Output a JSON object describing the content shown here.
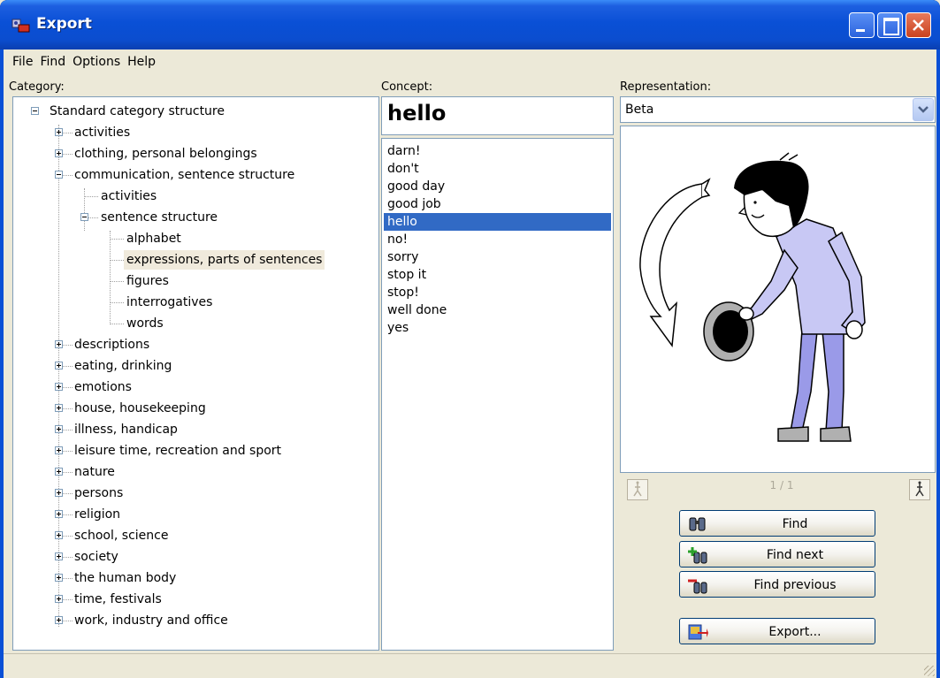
{
  "window": {
    "title": "Export"
  },
  "menu": [
    "File",
    "Find",
    "Options",
    "Help"
  ],
  "labels": {
    "category": "Category:",
    "concept": "Concept:",
    "representation": "Representation:"
  },
  "tree": {
    "root": "Standard category structure",
    "items": [
      "activities",
      "clothing, personal belongings",
      "communication, sentence structure",
      "activities",
      "sentence structure",
      "alphabet",
      "expressions, parts of sentences",
      "figures",
      "interrogatives",
      "words",
      "descriptions",
      "eating, drinking",
      "emotions",
      "house, housekeeping",
      "illness, handicap",
      "leisure time, recreation and sport",
      "nature",
      "persons",
      "religion",
      "school, science",
      "society",
      "the human body",
      "time, festivals",
      "work, industry and office"
    ]
  },
  "concept": {
    "current": "hello",
    "list": [
      "darn!",
      "don't",
      "good day",
      "good job",
      "hello",
      "no!",
      "sorry",
      "stop it",
      "stop!",
      "well done",
      "yes"
    ]
  },
  "representation": {
    "selected": "Beta",
    "counter": "1 / 1"
  },
  "buttons": {
    "find": "Find",
    "find_next": "Find next",
    "find_previous": "Find previous",
    "export": "Export..."
  },
  "colors": {
    "titlebar": "#0a50d6",
    "selection": "#316ac5",
    "window_bg": "#ece9d8"
  },
  "icons": {
    "title": "app-icon",
    "find": "binoculars-icon",
    "find_next": "binoculars-plus-icon",
    "find_previous": "binoculars-minus-icon",
    "export": "export-icon"
  }
}
